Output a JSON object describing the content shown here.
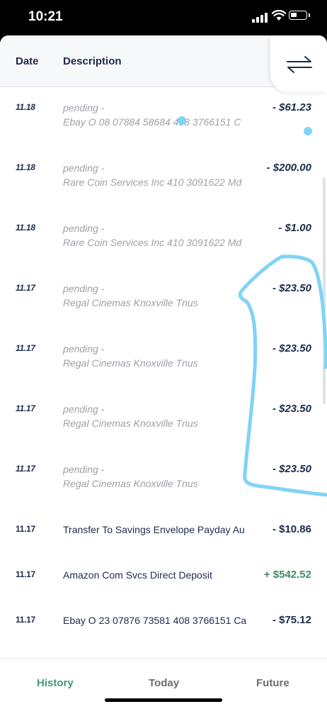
{
  "status_bar": {
    "time": "10:21"
  },
  "header": {
    "date_label": "Date",
    "description_label": "Description",
    "swap_icon": "swap-arrows-icon"
  },
  "transactions_pending": [
    {
      "date": "11.18",
      "status": "pending -",
      "description": "Ebay O 08 07884 58684 408 3766151 C",
      "amount": "- $61.23"
    },
    {
      "date": "11.18",
      "status": "pending -",
      "description": "Rare Coin Services Inc 410 3091622 Md",
      "amount": "- $200.00"
    },
    {
      "date": "11.18",
      "status": "pending -",
      "description": "Rare Coin Services Inc 410 3091622 Md",
      "amount": "- $1.00"
    },
    {
      "date": "11.17",
      "status": "pending -",
      "description": "Regal Cinemas Knoxville Tnus",
      "amount": "- $23.50"
    },
    {
      "date": "11.17",
      "status": "pending -",
      "description": "Regal Cinemas Knoxville Tnus",
      "amount": "- $23.50"
    },
    {
      "date": "11.17",
      "status": "pending -",
      "description": "Regal Cinemas Knoxville Tnus",
      "amount": "- $23.50"
    },
    {
      "date": "11.17",
      "status": "pending -",
      "description": "Regal Cinemas Knoxville Tnus",
      "amount": "- $23.50"
    }
  ],
  "transactions_posted": [
    {
      "date": "11.17",
      "description": "Transfer To Savings Envelope Payday Au",
      "amount": "- $10.86"
    },
    {
      "date": "11.17",
      "description": "Amazon Com Svcs Direct Deposit",
      "amount": "+ $542.52"
    },
    {
      "date": "11.17",
      "description": "Ebay O 23 07876 73581 408 3766151 Ca",
      "amount": "- $75.12"
    }
  ],
  "tabs": {
    "history": "History",
    "today": "Today",
    "future": "Future"
  },
  "colors": {
    "accent": "#3f9a7a",
    "text": "#1c2b4a",
    "muted": "#9da1a8",
    "credit": "#3f8c63",
    "annotation": "#7fd3f7"
  }
}
